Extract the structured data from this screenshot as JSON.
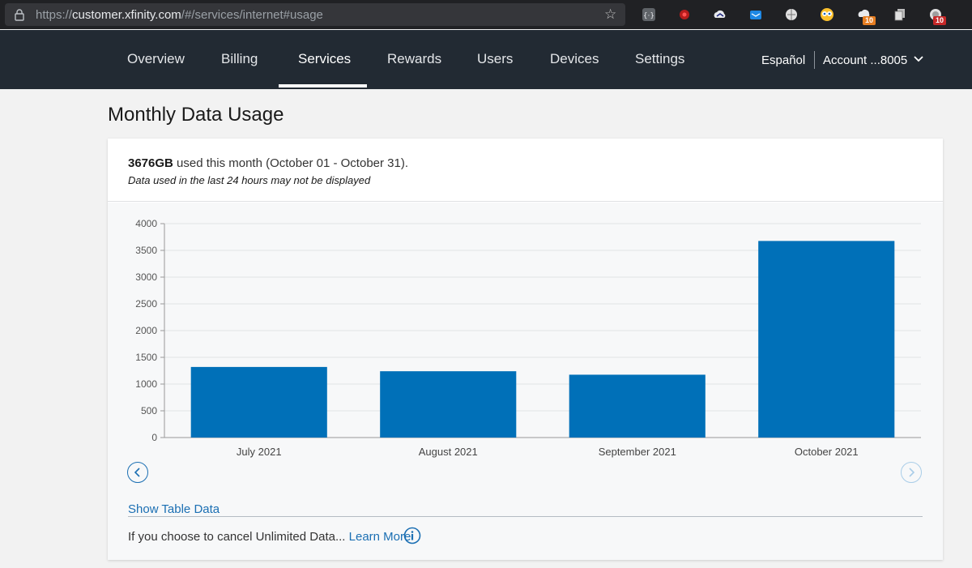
{
  "browser": {
    "url_prefix": "https://",
    "url_host": "customer.xfinity.com",
    "url_path": "/#/services/internet#usage",
    "extension_badges": [
      "10",
      "10"
    ]
  },
  "nav": {
    "items": [
      {
        "label": "Overview"
      },
      {
        "label": "Billing"
      },
      {
        "label": "Services"
      },
      {
        "label": "Rewards"
      },
      {
        "label": "Users"
      },
      {
        "label": "Devices"
      },
      {
        "label": "Settings"
      }
    ],
    "active": "Services",
    "language": "Español",
    "account": "Account ...8005"
  },
  "page": {
    "title": "Monthly Data Usage"
  },
  "usage": {
    "amount": "3676GB",
    "text": " used this month (October 01 - October 31).",
    "note": "Data used in the last 24 hours may not be displayed"
  },
  "footer": {
    "show_table": "Show Table Data",
    "cancel_text": "If you choose to cancel Unlimited Data... ",
    "learn_more": "Learn More"
  },
  "colors": {
    "bar": "#0070b8",
    "accent": "#1b6fb3",
    "nav_bg": "#222a33"
  },
  "chart_data": {
    "type": "bar",
    "categories": [
      "July 2021",
      "August 2021",
      "September 2021",
      "October 2021"
    ],
    "values": [
      1320,
      1240,
      1175,
      3676
    ],
    "ylim": [
      0,
      4000
    ],
    "yticks": [
      0,
      500,
      1000,
      1500,
      2000,
      2500,
      3000,
      3500,
      4000
    ],
    "grid": true,
    "xlabel": "",
    "ylabel": "",
    "title": ""
  }
}
